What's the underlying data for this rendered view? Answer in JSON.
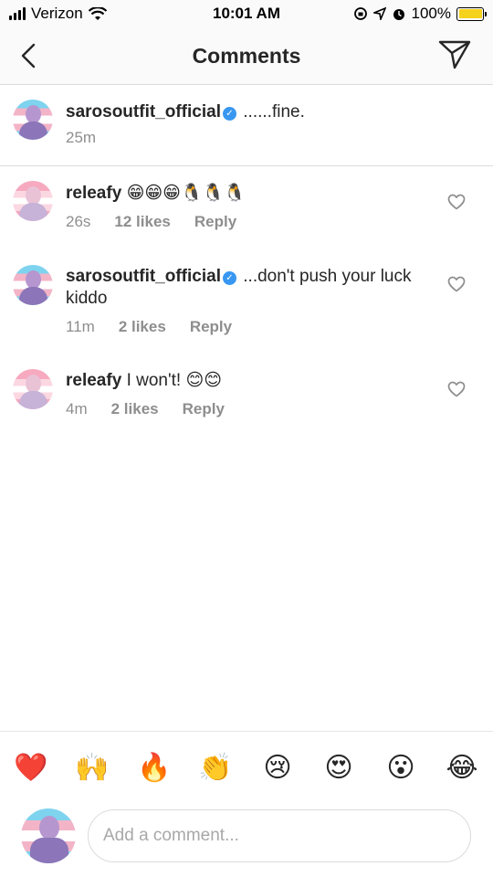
{
  "status_bar": {
    "carrier": "Verizon",
    "time": "10:01 AM",
    "battery": "100%"
  },
  "header": {
    "title": "Comments"
  },
  "caption": {
    "username": "sarosoutfit_official",
    "text": "......fine.",
    "time": "25m"
  },
  "comments": [
    {
      "username": "releafy",
      "text": "😁😁😁🐧🐧🐧",
      "time": "26s",
      "likes": "12 likes",
      "reply": "Reply"
    },
    {
      "username": "sarosoutfit_official",
      "text": "...don't push your luck kiddo",
      "time": "11m",
      "likes": "2 likes",
      "reply": "Reply"
    },
    {
      "username": "releafy",
      "text": "I won't! 😊😊",
      "time": "4m",
      "likes": "2 likes",
      "reply": "Reply"
    }
  ],
  "emoji_bar": [
    "❤️",
    "🙌",
    "🔥",
    "👏",
    "😢",
    "😍",
    "😮",
    "😂"
  ],
  "composer": {
    "placeholder": "Add a comment..."
  },
  "colors": {
    "verified_blue": "#3897f0",
    "meta_gray": "#8e8e8e",
    "battery_yellow": "#f5d21c"
  }
}
